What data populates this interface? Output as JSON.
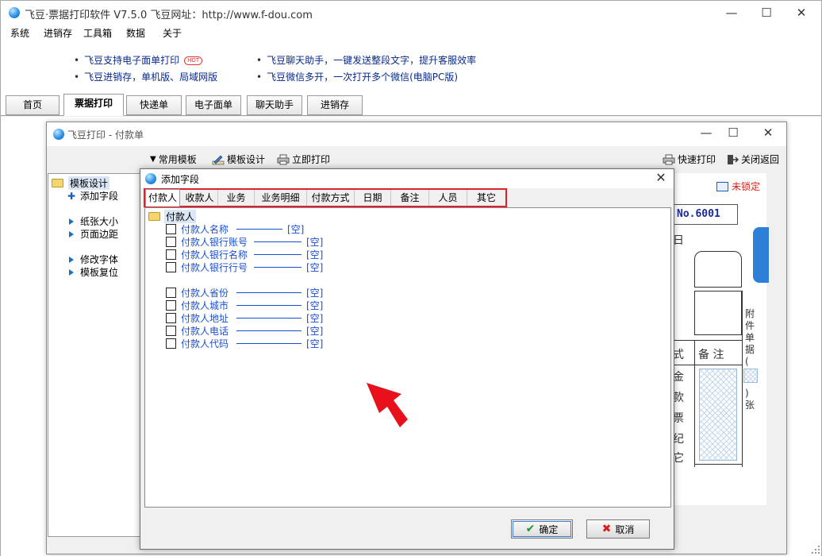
{
  "app": {
    "title": "飞豆·票据打印软件 V7.5.0   飞豆网址：http://www.f-dou.com",
    "minimize": "—",
    "maximize": "☐",
    "close": "✕"
  },
  "menu": [
    "系统",
    "进销存",
    "工具箱",
    "数据",
    "关于"
  ],
  "promo": [
    {
      "text": "飞豆支持电子面单打印",
      "badge": "HOT"
    },
    {
      "text": "飞豆进销存，单机版、局域网版"
    },
    {
      "text": "飞豆聊天助手，一键发送整段文字，提升客服效率"
    },
    {
      "text": "飞豆微信多开，一次打开多个微信(电脑PC版)"
    }
  ],
  "main_tabs": [
    "首页",
    "票据打印",
    "快递单",
    "电子面单",
    "聊天助手",
    "进销存"
  ],
  "active_main_tab": "票据打印",
  "sub_window": {
    "title": "飞豆打印 - 付款单",
    "toolbar": {
      "templates": "常用模板",
      "design": "模板设计",
      "print_now": "立即打印",
      "quick_print": "快速打印",
      "close_return": "关闭返回"
    },
    "left_panel": {
      "root": "模板设计",
      "items": [
        "添加字段",
        "纸张大小",
        "页面边距",
        "修改字体",
        "模板复位"
      ]
    },
    "preview": {
      "lock_status": "未锁定",
      "number": "No.6001",
      "date_char": "日",
      "attach_label": "附件单据(",
      "attach_suffix": ")张",
      "col_mode": "式",
      "col_remark": "备 注",
      "row_chars": [
        "金",
        "款",
        "票",
        "纪",
        "它"
      ]
    }
  },
  "dialog": {
    "title": "添加字段",
    "close": "✕",
    "tabs": [
      "付款人",
      "收款人",
      "业务",
      "业务明细",
      "付款方式",
      "日期",
      "备注",
      "人员",
      "其它"
    ],
    "active_tab": "付款人",
    "root_node": "付款人",
    "fields_group1": [
      {
        "name": "付款人名称",
        "value": "[空]",
        "checked": false
      },
      {
        "name": "付款人银行账号",
        "value": "[空]",
        "checked": false
      },
      {
        "name": "付款人银行名称",
        "value": "[空]",
        "checked": false
      },
      {
        "name": "付款人银行行号",
        "value": "[空]",
        "checked": false
      }
    ],
    "fields_group2": [
      {
        "name": "付款人省份",
        "value": "[空]",
        "checked": false
      },
      {
        "name": "付款人城市",
        "value": "[空]",
        "checked": false
      },
      {
        "name": "付款人地址",
        "value": "[空]",
        "checked": false
      },
      {
        "name": "付款人电话",
        "value": "[空]",
        "checked": false
      },
      {
        "name": "付款人代码",
        "value": "[空]",
        "checked": false
      }
    ],
    "ok_label": "确定",
    "cancel_label": "取消"
  },
  "icons": {
    "app": "app-logo-icon",
    "folder": "folder-icon",
    "add": "plus-icon",
    "bullet": "triangle-right-icon",
    "design": "pencil-icon",
    "printer": "printer-icon",
    "exit": "exit-icon",
    "lock": "lock-icon",
    "ok": "check-icon",
    "cancel": "x-icon"
  },
  "colors": {
    "accent_red": "#e0202a",
    "link_blue": "#1a4fd0",
    "promo_blue": "#0a2a8c"
  }
}
